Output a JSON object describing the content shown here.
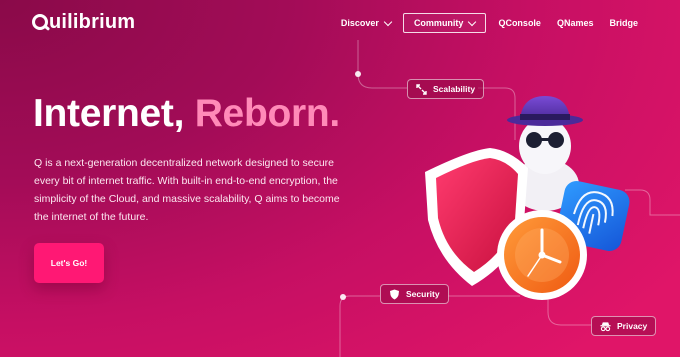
{
  "brand": {
    "name": "uilibrium"
  },
  "nav": {
    "items": [
      {
        "label": "Discover",
        "dropdown": true
      },
      {
        "label": "Community",
        "dropdown": true,
        "active": true
      },
      {
        "label": "QConsole"
      },
      {
        "label": "QNames"
      },
      {
        "label": "Bridge"
      }
    ]
  },
  "hero": {
    "title_part1": "Internet, ",
    "title_part2": "Reborn.",
    "description": "Q is a next-generation decentralized network designed to secure every bit of internet traffic. With built-in end-to-end encryption, the simplicity of the Cloud, and massive scalability, Q aims to become the internet of the future.",
    "cta": "Let's Go!"
  },
  "tags": {
    "scalability": "Scalability",
    "security": "Security",
    "privacy": "Privacy"
  },
  "colors": {
    "accent": "#ff1874",
    "title_accent": "#ff8ab8",
    "bg_dark": "#8a0a49",
    "bg_light": "#e01568"
  },
  "icons": {
    "scalability": "expand-arrows-icon",
    "security": "shield-icon",
    "privacy": "spy-incognito-icon"
  }
}
